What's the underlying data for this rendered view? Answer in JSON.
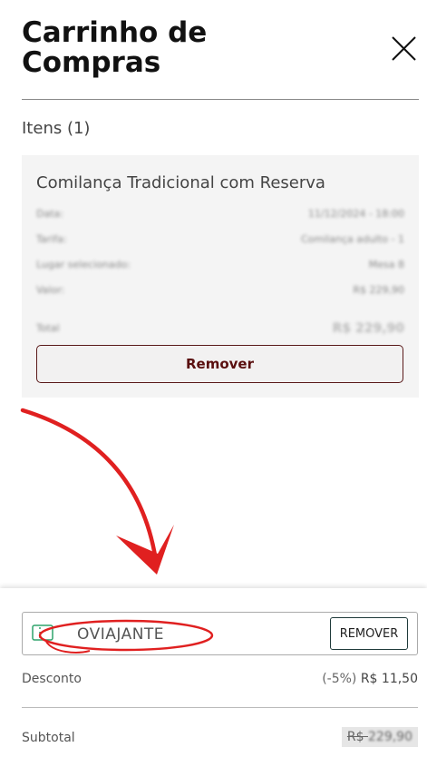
{
  "header": {
    "title": "Carrinho de Compras",
    "close_icon": "close-icon"
  },
  "items": {
    "heading": "Itens (1)",
    "list": [
      {
        "name": "Comilança Tradicional com Reserva",
        "details": [
          {
            "label": "Data:",
            "value": "11/12/2024 - 18:00"
          },
          {
            "label": "Tarifa:",
            "value": "Comilança adulto - 1"
          },
          {
            "label": "Lugar selecionado:",
            "value": "Mesa 8"
          },
          {
            "label": "Valor:",
            "value": "R$ 229,90"
          }
        ],
        "total_label": "Total",
        "total_value": "R$ 229,90",
        "remove_label": "Remover"
      }
    ]
  },
  "coupon": {
    "icon": "ticket-icon",
    "code": "OVIAJANTE",
    "remove_label": "REMOVER"
  },
  "summary": {
    "discount_label": "Desconto",
    "discount_percent": "(-5%)",
    "discount_value": "R$ 11,50",
    "subtotal_label": "Subtotal",
    "subtotal_currency": "R$",
    "subtotal_value": "229,90"
  },
  "colors": {
    "remove_button_text": "#5a0f0f",
    "annotation_red": "#e02020",
    "coupon_icon": "#2fa36b"
  }
}
